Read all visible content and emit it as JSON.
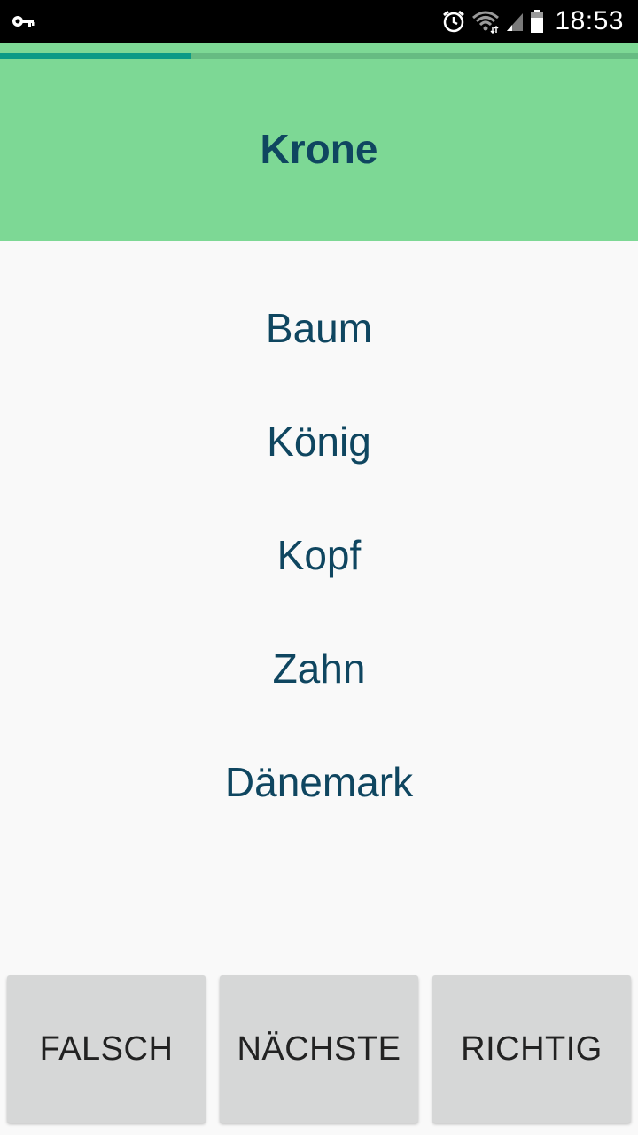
{
  "status_bar": {
    "time": "18:53",
    "icons": [
      "key-icon",
      "alarm-icon",
      "wifi-icon",
      "signal-icon",
      "battery-icon"
    ]
  },
  "progress": {
    "value": 0.3,
    "fill_color": "#0c9a86",
    "track_color": "#66bb82"
  },
  "question": {
    "word": "Krone",
    "background_color": "#7dd895"
  },
  "options": [
    {
      "label": "Baum"
    },
    {
      "label": "König"
    },
    {
      "label": "Kopf"
    },
    {
      "label": "Zahn"
    },
    {
      "label": "Dänemark"
    }
  ],
  "buttons": {
    "wrong": "FALSCH",
    "next": "NÄCHSTE",
    "right": "RICHTIG"
  },
  "colors": {
    "text_primary": "#0f4660",
    "background": "#f9f9f9",
    "button_bg": "#d6d7d7"
  }
}
